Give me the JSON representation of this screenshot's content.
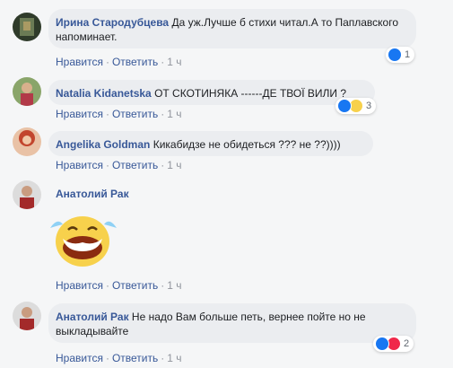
{
  "comments": [
    {
      "author": "Ирина Стародубцева",
      "text": "Да уж.Лучше б стихи читал.А то Паплавского напоминает.",
      "reactions": {
        "types": [
          "like"
        ],
        "count": "1"
      },
      "actions": {
        "like": "Нравится",
        "reply": "Ответить",
        "time": "1 ч"
      }
    },
    {
      "author": "Natalia Kidanetska",
      "text": "ОТ СКОТИНЯКА ------ДЕ ТВОЇ ВИЛИ ?",
      "reactions": {
        "types": [
          "like",
          "haha"
        ],
        "count": "3"
      },
      "actions": {
        "like": "Нравится",
        "reply": "Ответить",
        "time": "1 ч"
      }
    },
    {
      "author": "Angelika Goldman",
      "text": "Кикабидзе не обидеться ??? не ??))))",
      "actions": {
        "like": "Нравится",
        "reply": "Ответить",
        "time": "1 ч"
      }
    },
    {
      "author": "Анатолий Рак",
      "sticker": "laughing-tears-sticker",
      "actions": {
        "like": "Нравится",
        "reply": "Ответить",
        "time": "1 ч"
      }
    },
    {
      "author": "Анатолий Рак",
      "text": "Не надо Вам больше петь, вернее пойте но не выкладывайте",
      "reactions": {
        "types": [
          "like",
          "love"
        ],
        "count": "2"
      },
      "actions": {
        "like": "Нравится",
        "reply": "Ответить",
        "time": "1 ч"
      }
    }
  ],
  "colors": {
    "author": "#385898",
    "bubble": "#ebedf0",
    "meta": "#90949c",
    "like": "#1877f2",
    "love": "#f0284a",
    "haha": "#f7d14c"
  }
}
